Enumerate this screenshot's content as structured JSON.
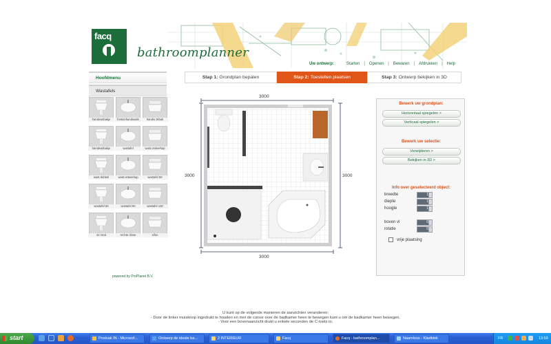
{
  "header": {
    "logo_text": "facq",
    "product_name": "bathroomplanner"
  },
  "menu": {
    "label": "Uw ontwerp:",
    "items": [
      "Starten",
      "Openen",
      "Bewaren",
      "Afdrukken",
      "Help"
    ]
  },
  "sidebar": {
    "tabs": [
      "Hoofdmenu",
      "Wastafels"
    ],
    "fixtures": [
      {
        "label": "handwasbakje"
      },
      {
        "label": "fonteinhandwasb"
      },
      {
        "label": "handw zitbak"
      },
      {
        "label": "handwasbakje"
      },
      {
        "label": "wastafel"
      },
      {
        "label": "wast.ontwerkap"
      },
      {
        "label": "wast.dubbel"
      },
      {
        "label": "wast.ontwerkap"
      },
      {
        "label": "wastafel 50"
      },
      {
        "label": "wastafel 60"
      },
      {
        "label": "wastafel 80"
      },
      {
        "label": "wastafel 100"
      },
      {
        "label": "42 rond"
      },
      {
        "label": "rechte dinse"
      },
      {
        "label": "sifon"
      }
    ],
    "powered_by": "powered by ProPlanet B.V."
  },
  "steps": [
    {
      "num": "Stap 1:",
      "label": "Grondplan bepalen"
    },
    {
      "num": "Stap 2:",
      "label": "Toestellen plaatsen"
    },
    {
      "num": "Stap 3:",
      "label": "Ontwerp bekijken in 3D"
    }
  ],
  "plan": {
    "dim_top": "3000",
    "dim_bottom": "3000",
    "dim_left": "3000",
    "dim_right": "3000"
  },
  "panel": {
    "floorplan_heading": "Bewerk uw grondplan:",
    "btn_horizontal": "Horizontaal spiegelen >",
    "btn_vertical": "Verticaal spiegelen >",
    "selection_heading": "Bewerk uw selectie:",
    "btn_remove": "Verwijderen >",
    "btn_3d": "Bekijken in 3D >",
    "info_heading": "Info over geselecteerd object:",
    "props": [
      {
        "label": "breedte",
        "value": "1"
      },
      {
        "label": "diepte",
        "value": "1"
      },
      {
        "label": "hoogte",
        "value": "1"
      },
      {
        "label": "boven vl",
        "value": "0"
      },
      {
        "label": "rotatie",
        "value": "0"
      }
    ],
    "free_placement": "vrije plaatsing"
  },
  "info_lines": [
    "U kunt op de volgende manieren de aanzichten veranderen:",
    "- Door de linker muisknop ingedrukt te houden en met de cursor over de badkamer heen te bewegen kunt u om de badkamer heen bewegen.",
    "- Voor een bovenaanzicht drukt u enkele seconden de C-toets in."
  ],
  "taskbar": {
    "start": "start",
    "tasks": [
      "Postvak IN - Microsof...",
      "Ontwerp de ideale ba...",
      "2 INTERIEUR",
      "Facq",
      "Facq - bathroomplan...",
      "Naamloos - Kladblok"
    ],
    "lang": "FR",
    "clock": "13:59"
  }
}
